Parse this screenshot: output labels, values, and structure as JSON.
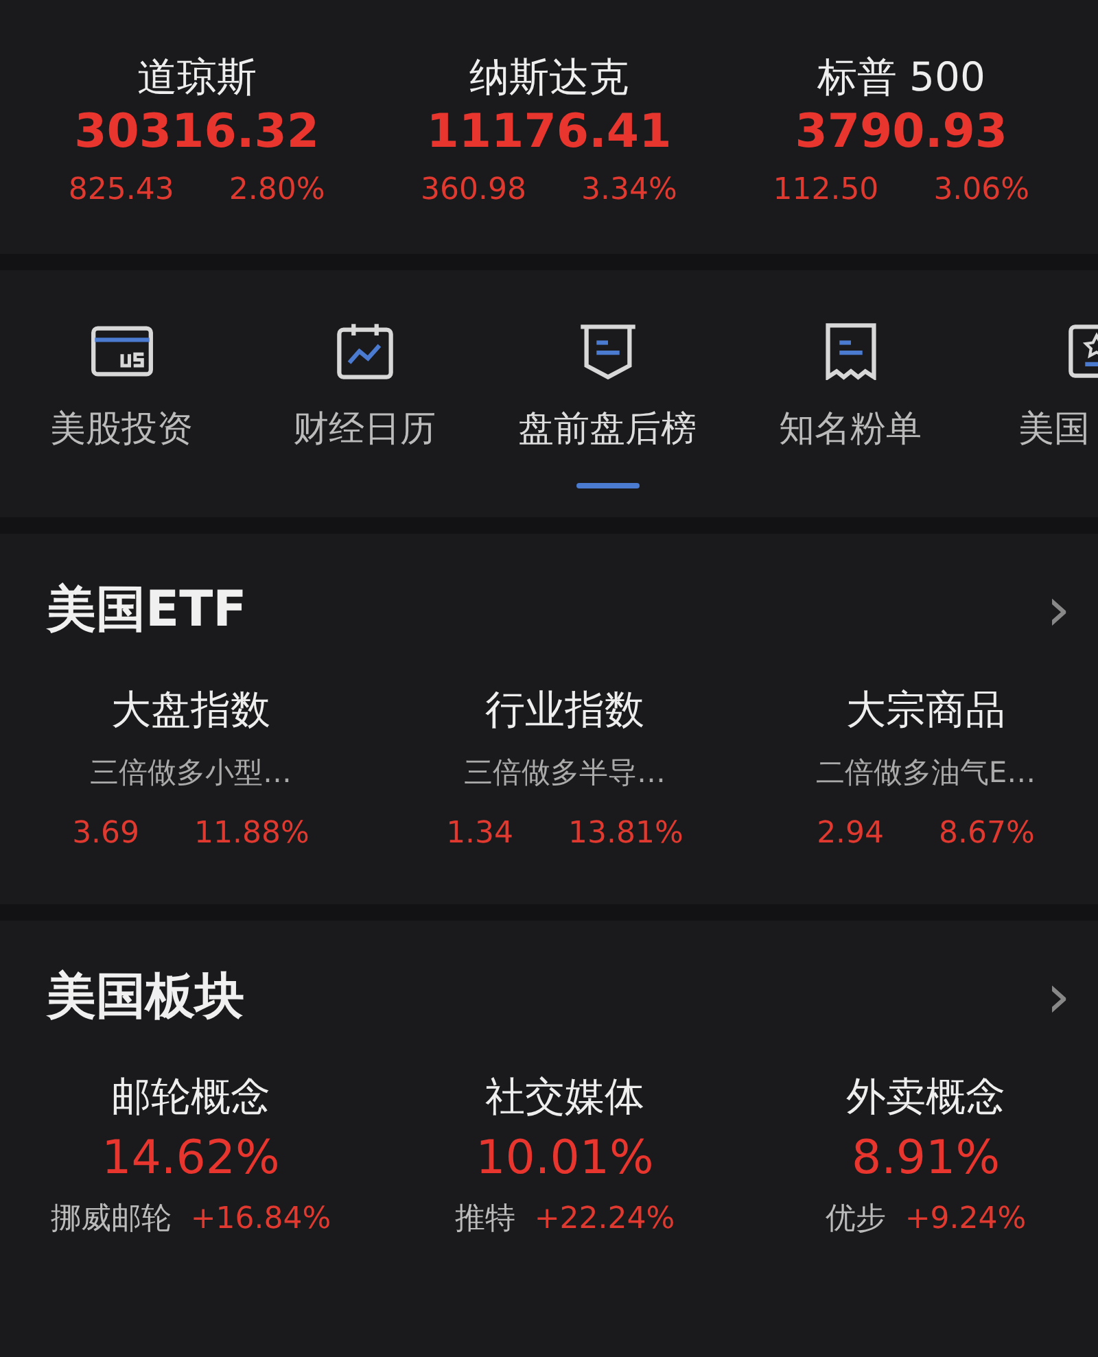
{
  "indices": [
    {
      "name": "道琼斯",
      "price": "30316.32",
      "change": "825.43",
      "percent": "2.80%"
    },
    {
      "name": "纳斯达克",
      "price": "11176.41",
      "change": "360.98",
      "percent": "3.34%"
    },
    {
      "name": "标普 500",
      "price": "3790.93",
      "change": "112.50",
      "percent": "3.06%"
    }
  ],
  "nav": [
    {
      "kind": "us",
      "label": "美股投资",
      "selected": false
    },
    {
      "kind": "calendar",
      "label": "财经日历",
      "selected": false
    },
    {
      "kind": "banner",
      "label": "盘前盘后榜",
      "selected": true
    },
    {
      "kind": "receipt",
      "label": "知名粉单",
      "selected": false
    },
    {
      "kind": "star",
      "label": "美国",
      "selected": false
    }
  ],
  "etf": {
    "title": "美国ETF",
    "arrow": "›",
    "items": [
      {
        "category": "大盘指数",
        "fund": "三倍做多小型…",
        "price": "3.69",
        "percent": "11.88%"
      },
      {
        "category": "行业指数",
        "fund": "三倍做多半导…",
        "price": "1.34",
        "percent": "13.81%"
      },
      {
        "category": "大宗商品",
        "fund": "二倍做多油气E…",
        "price": "2.94",
        "percent": "8.67%"
      }
    ]
  },
  "sectors": {
    "title": "美国板块",
    "arrow": "›",
    "items": [
      {
        "name": "邮轮概念",
        "percent": "14.62%",
        "leader": "挪威邮轮",
        "leader_change": "+16.84%"
      },
      {
        "name": "社交媒体",
        "percent": "10.01%",
        "leader": "推特",
        "leader_change": "+22.24%"
      },
      {
        "name": "外卖概念",
        "percent": "8.91%",
        "leader": "优步",
        "leader_change": "+9.24%"
      }
    ]
  }
}
